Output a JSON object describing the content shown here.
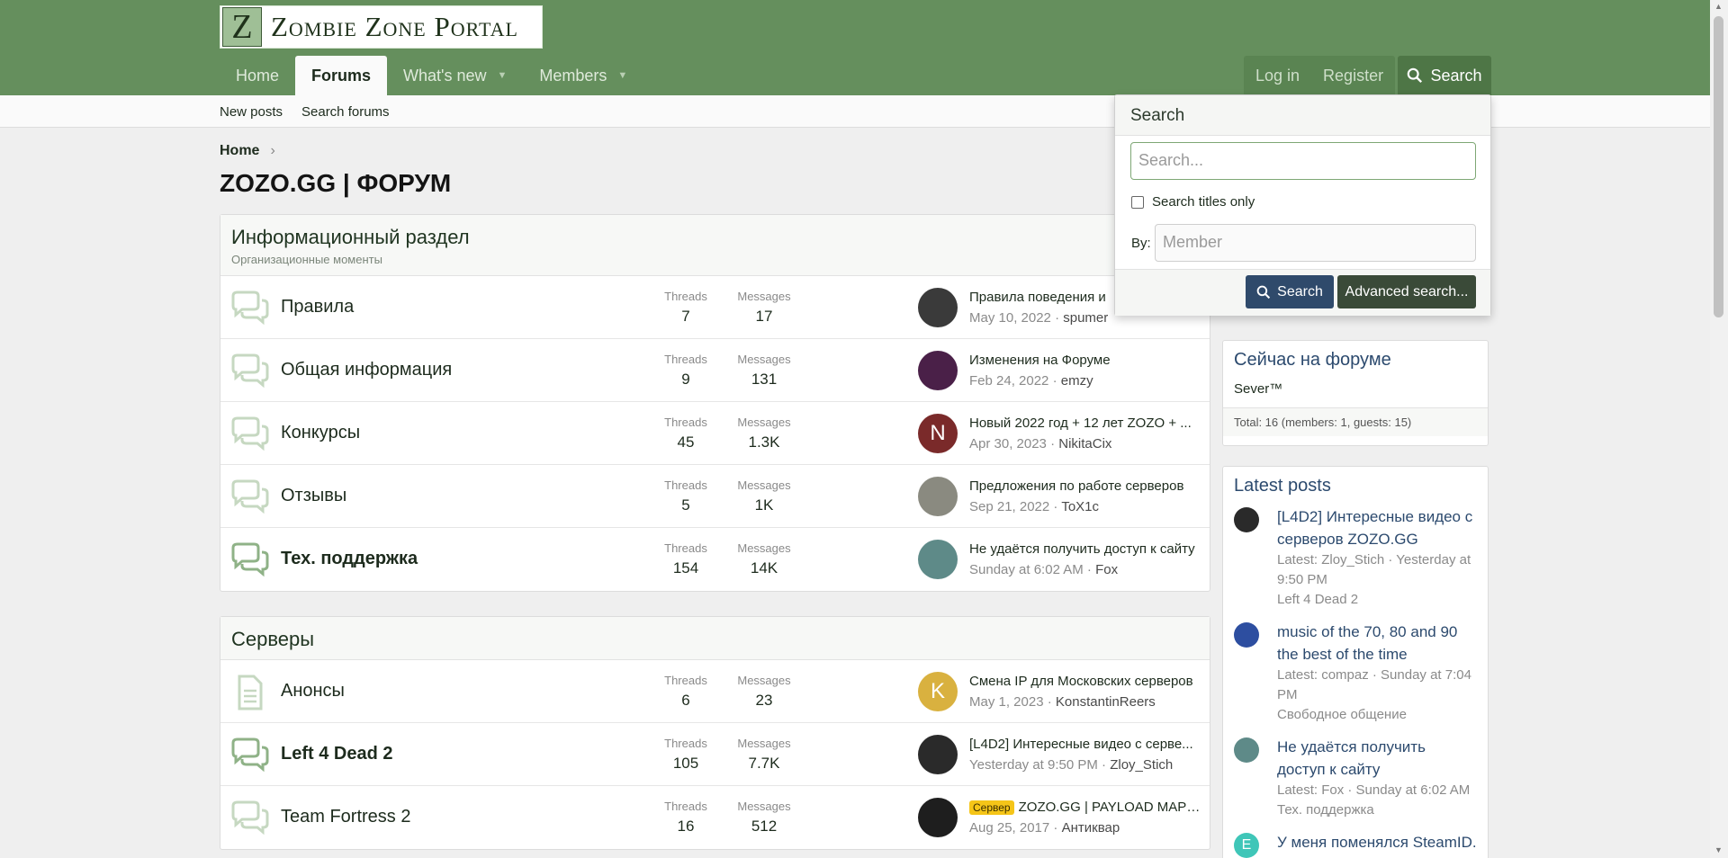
{
  "logo": {
    "letter": "Z",
    "title": "Zombie Zone Portal"
  },
  "nav": {
    "home": "Home",
    "forums": "Forums",
    "whats_new": "What's new",
    "members": "Members",
    "login": "Log in",
    "register": "Register",
    "search": "Search"
  },
  "subnav": {
    "new_posts": "New posts",
    "search_forums": "Search forums"
  },
  "breadcrumb": {
    "home": "Home"
  },
  "page_title": "ZOZO.GG | ФОРУМ",
  "categories": [
    {
      "title": "Информационный раздел",
      "description": "Организационные моменты",
      "forums": [
        {
          "name": "Правила",
          "bold": false,
          "threads_label": "Threads",
          "threads": "7",
          "messages_label": "Messages",
          "messages": "17",
          "last_title": "Правила поведения и",
          "last_date": "May 10, 2022",
          "last_user": "spumer",
          "avatar_color": "#3a3a3a",
          "avatar_letter": ""
        },
        {
          "name": "Общая информация",
          "bold": false,
          "threads_label": "Threads",
          "threads": "9",
          "messages_label": "Messages",
          "messages": "131",
          "last_title": "Изменения на Форуме",
          "last_date": "Feb 24, 2022",
          "last_user": "emzy",
          "avatar_color": "#4a2048",
          "avatar_letter": ""
        },
        {
          "name": "Конкурсы",
          "bold": false,
          "threads_label": "Threads",
          "threads": "45",
          "messages_label": "Messages",
          "messages": "1.3K",
          "last_title": "Новый 2022 год + 12 лет ZOZO + ...",
          "last_date": "Apr 30, 2023",
          "last_user": "NikitaCix",
          "avatar_color": "#7a2a2a",
          "avatar_letter": "N"
        },
        {
          "name": "Отзывы",
          "bold": false,
          "threads_label": "Threads",
          "threads": "5",
          "messages_label": "Messages",
          "messages": "1K",
          "last_title": "Предложения по работе серверов",
          "last_date": "Sep 21, 2022",
          "last_user": "ToX1c",
          "avatar_color": "#8a8a80",
          "avatar_letter": ""
        },
        {
          "name": "Тех. поддержка",
          "bold": true,
          "threads_label": "Threads",
          "threads": "154",
          "messages_label": "Messages",
          "messages": "14K",
          "last_title": "Не удаётся получить доступ к сайту",
          "last_date": "Sunday at 6:02 AM",
          "last_user": "Fox",
          "avatar_color": "#5e8a88",
          "avatar_letter": ""
        }
      ]
    },
    {
      "title": "Серверы",
      "description": "",
      "forums": [
        {
          "name": "Анонсы",
          "bold": false,
          "threads_label": "Threads",
          "threads": "6",
          "messages_label": "Messages",
          "messages": "23",
          "last_title": "Смена IP для Московских серверов",
          "last_date": "May 1, 2023",
          "last_user": "KonstantinReers",
          "avatar_color": "#d9b13f",
          "avatar_letter": "K"
        },
        {
          "name": "Left 4 Dead 2",
          "bold": true,
          "threads_label": "Threads",
          "threads": "105",
          "messages_label": "Messages",
          "messages": "7.7K",
          "last_title": "[L4D2] Интересные видео с серве...",
          "last_date": "Yesterday at 9:50 PM",
          "last_user": "Zloy_Stich",
          "avatar_color": "#2a2a2a",
          "avatar_letter": ""
        },
        {
          "name": "Team Fortress 2",
          "bold": false,
          "threads_label": "Threads",
          "threads": "16",
          "messages_label": "Messages",
          "messages": "512",
          "last_title": "ZOZO.GG | PAYLOAD MAPS...",
          "last_tag": "Сервер",
          "last_date": "Aug 25, 2017",
          "last_user": "Антиквар",
          "avatar_color": "#1e1e1e",
          "avatar_letter": ""
        }
      ]
    }
  ],
  "sidebar": {
    "online": {
      "title": "Сейчас на форуме",
      "members": "Sever™",
      "total": "Total: 16 (members: 1, guests: 15)"
    },
    "latest": {
      "title": "Latest posts",
      "posts": [
        {
          "title": "[L4D2] Интересные видео с серверов ZOZO.GG",
          "meta": "Latest: Zloy_Stich · Yesterday at 9:50 PM",
          "forum": "Left 4 Dead 2",
          "avatar_color": "#2a2a2a",
          "avatar_letter": ""
        },
        {
          "title": "music of the 70, 80 and 90 the best of the time",
          "meta": "Latest: compaz · Sunday at 7:04 PM",
          "forum": "Свободное общение",
          "avatar_color": "#2d4ea0",
          "avatar_letter": ""
        },
        {
          "title": "Не удаётся получить доступ к сайту",
          "meta": "Latest: Fox · Sunday at 6:02 AM",
          "forum": "Тех. поддержка",
          "avatar_color": "#5e8a88",
          "avatar_letter": ""
        },
        {
          "title": "У меня поменялся SteamID.",
          "meta": "",
          "forum": "",
          "avatar_color": "#3fc6b8",
          "avatar_letter": "E"
        }
      ]
    }
  },
  "search_menu": {
    "title": "Search",
    "placeholder": "Search...",
    "titles_only": "Search titles only",
    "by_label": "By:",
    "member_placeholder": "Member",
    "search_button": "Search",
    "advanced_button": "Advanced search..."
  }
}
